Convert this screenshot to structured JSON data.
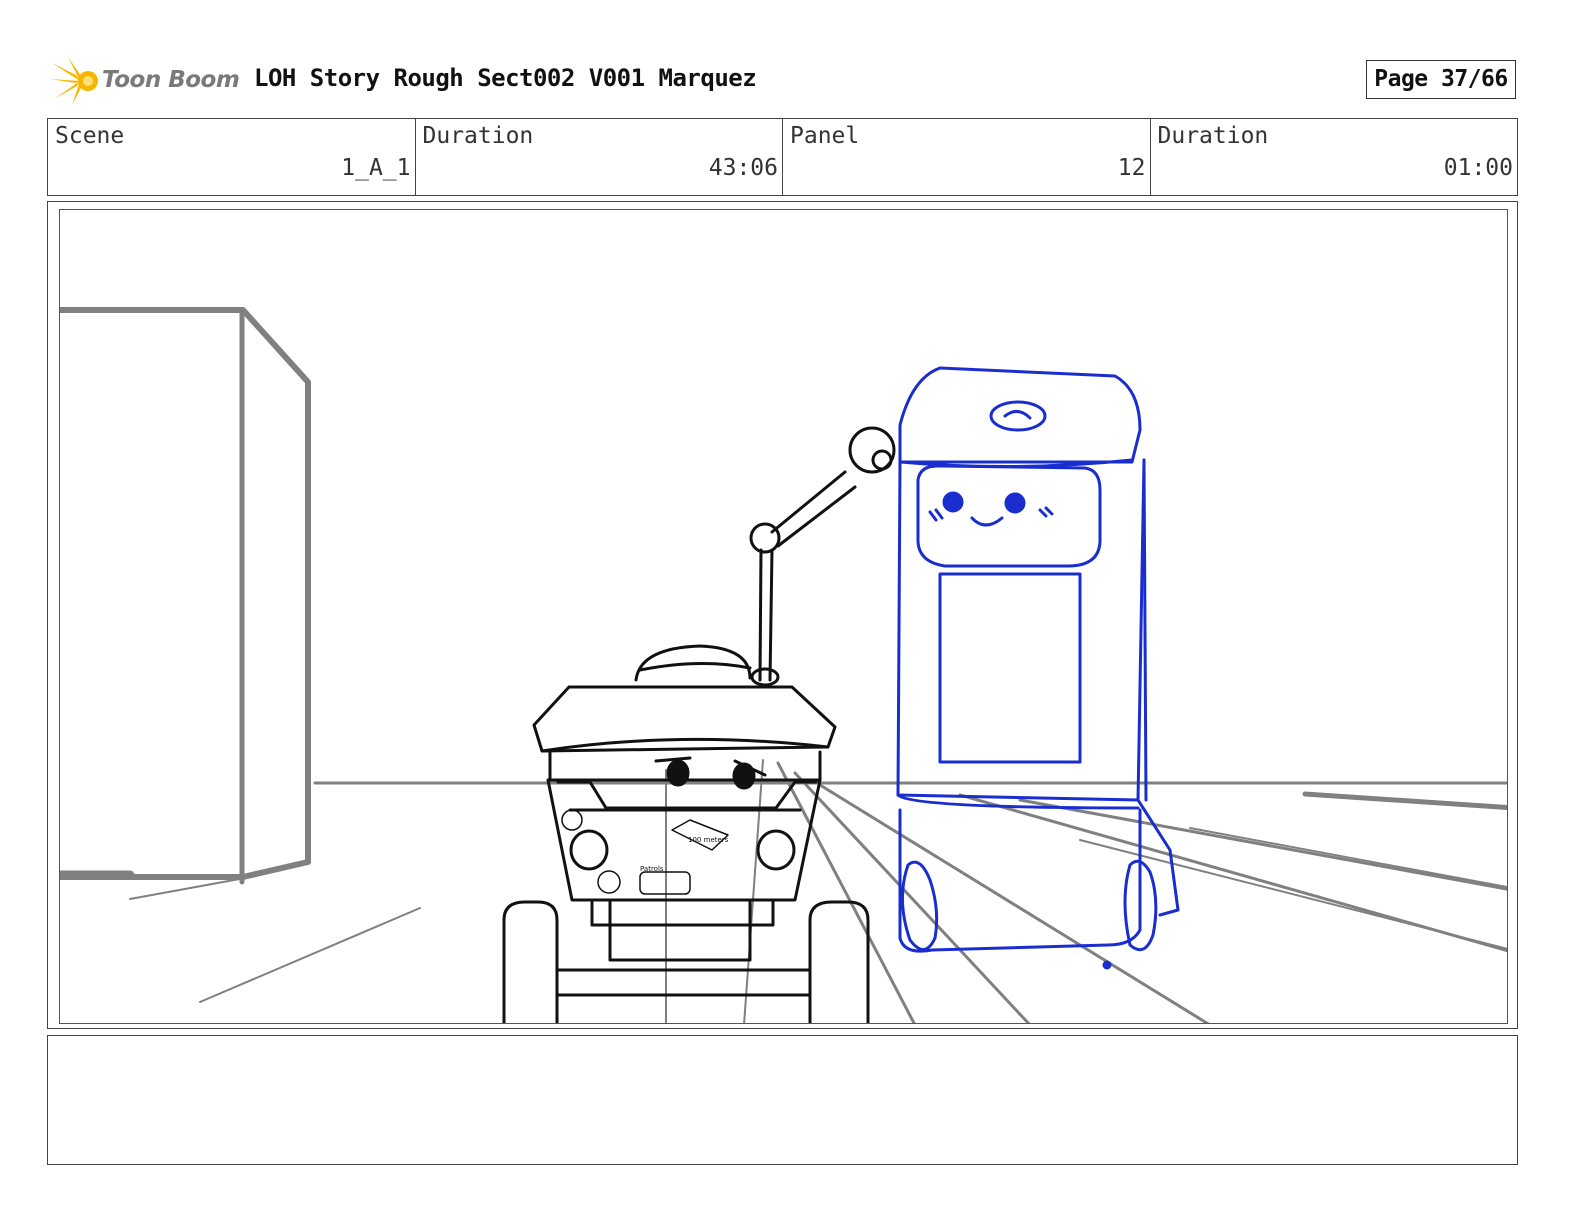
{
  "header": {
    "logo_text": "Toon Boom",
    "title": "LOH Story Rough Sect002 V001 Marquez",
    "page": "Page 37/66"
  },
  "info": {
    "scene_label": "Scene",
    "scene_value": "1_A_1",
    "scene_duration_label": "Duration",
    "scene_duration_value": "43:06",
    "panel_label": "Panel",
    "panel_value": "12",
    "panel_duration_label": "Duration",
    "panel_duration_value": "01:00"
  },
  "panel": {
    "sticker_text_1": "100 meters",
    "sticker_text_2": "Patrols",
    "colors": {
      "gray": "#808080",
      "black": "#111111",
      "blue": "#1a2ed0"
    }
  },
  "notes": {
    "text": ""
  }
}
